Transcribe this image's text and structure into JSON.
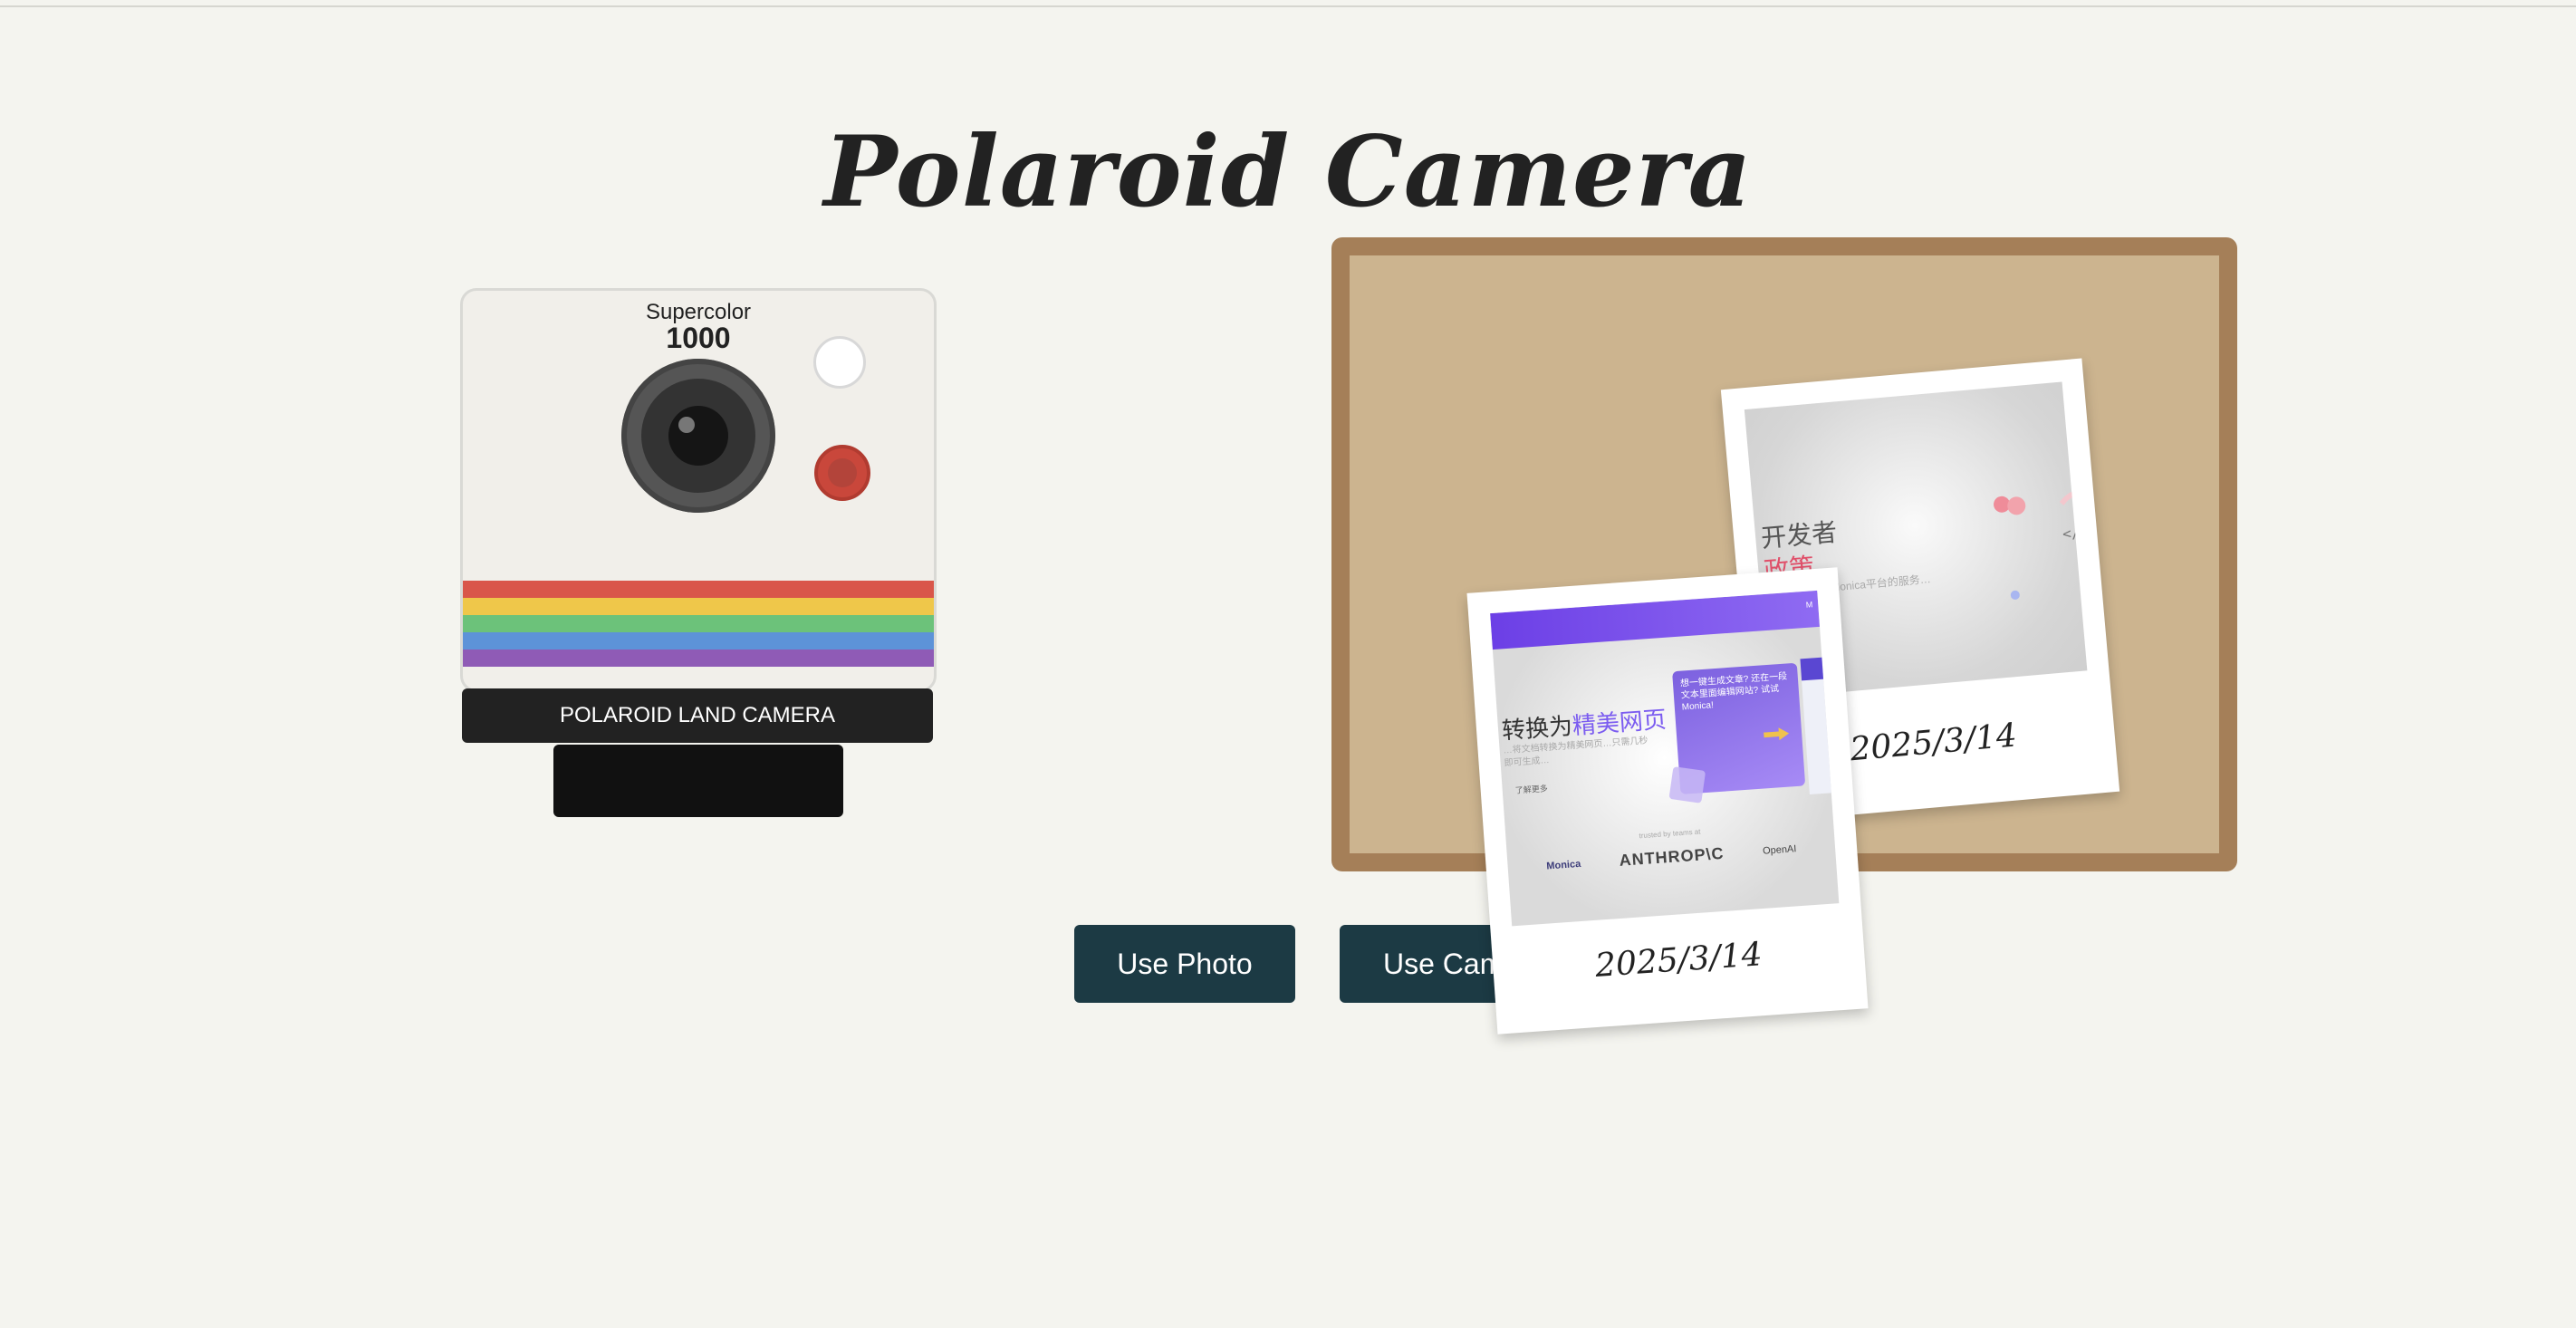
{
  "page": {
    "title": "Polaroid Camera"
  },
  "camera": {
    "brand": "Supercolor",
    "model": "1000",
    "label": "POLAROID LAND CAMERA",
    "stripe_colors": [
      "#d9564a",
      "#efc74a",
      "#6cc27a",
      "#5d93d8",
      "#8f5bb6"
    ]
  },
  "buttons": {
    "use_photo": "Use Photo",
    "use_camera": "Use Camera"
  },
  "photos": [
    {
      "date": "2025/3/14",
      "heading_line1": "开发者",
      "heading_line2": "政策",
      "subtext": "…开发者使用Monica平台的服务…",
      "code_glyph": "</>"
    },
    {
      "date": "2025/3/14",
      "heading_prefix": "转换为",
      "heading_highlight": "精美网页",
      "subtext": "…将文档转换为精美网页…只需几秒即可生成…",
      "small_text": "了解更多",
      "card_text": "想一键生成文章? 还在一段文本里面编辑网站? 试试Monica!",
      "nav_mark": "M",
      "trusted_text": "trusted by teams at",
      "logos": [
        "Monica",
        "ANTHROP\\C",
        "OpenAI"
      ]
    }
  ],
  "colors": {
    "button_bg": "#1c3a44",
    "board_frame": "#a57f58",
    "board_cork": "#ccb48f",
    "background": "#f4f4ef"
  }
}
